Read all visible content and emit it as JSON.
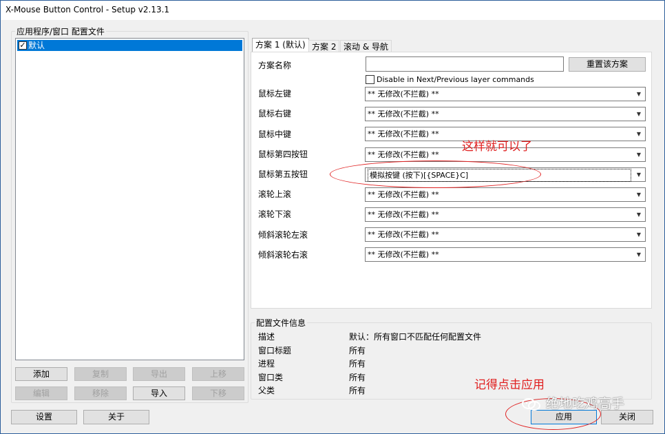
{
  "window": {
    "title": "X-Mouse Button Control - Setup v2.13.1"
  },
  "profiles": {
    "group_label": "应用程序/窗口 配置文件",
    "items": [
      {
        "label": "默认",
        "checked": true
      }
    ],
    "buttons": {
      "add": "添加",
      "copy": "复制",
      "export": "导出",
      "move_up": "上移",
      "edit": "编辑",
      "remove": "移除",
      "import": "导入",
      "move_down": "下移"
    }
  },
  "tabs": [
    {
      "label": "方案 1 (默认)",
      "active": true
    },
    {
      "label": "方案 2",
      "active": false
    },
    {
      "label": "滚动 & 导航",
      "active": false
    }
  ],
  "scheme": {
    "name_label": "方案名称",
    "name_value": "",
    "reset_button": "重置该方案",
    "disable_layer_label": "Disable in Next/Previous layer commands",
    "disable_layer_checked": false,
    "rows": [
      {
        "label": "鼠标左键",
        "value": "** 无修改(不拦截) **"
      },
      {
        "label": "鼠标右键",
        "value": "** 无修改(不拦截) **"
      },
      {
        "label": "鼠标中键",
        "value": "** 无修改(不拦截) **"
      },
      {
        "label": "鼠标第四按钮",
        "value": "** 无修改(不拦截) **"
      },
      {
        "label": "鼠标第五按钮",
        "value": "模拟按键 (按下)[{SPACE}C]"
      },
      {
        "label": "滚轮上滚",
        "value": "** 无修改(不拦截) **"
      },
      {
        "label": "滚轮下滚",
        "value": "** 无修改(不拦截) **"
      },
      {
        "label": "倾斜滚轮左滚",
        "value": "** 无修改(不拦截) **"
      },
      {
        "label": "倾斜滚轮右滚",
        "value": "** 无修改(不拦截) **"
      }
    ]
  },
  "profile_info": {
    "group_label": "配置文件信息",
    "rows": [
      {
        "label": "描述",
        "value": "默认：所有窗口不匹配任何配置文件"
      },
      {
        "label": "窗口标题",
        "value": "所有"
      },
      {
        "label": "进程",
        "value": "所有"
      },
      {
        "label": "窗口类",
        "value": "所有"
      },
      {
        "label": "父类",
        "value": "所有"
      }
    ]
  },
  "footer": {
    "settings": "设置",
    "about": "关于",
    "apply": "应用",
    "close": "关闭"
  },
  "annotations": {
    "good_enough": "这样就可以了",
    "remember_apply": "记得点击应用",
    "color": "#e02020"
  },
  "watermark": {
    "text": "绝地吃鸡高手"
  }
}
